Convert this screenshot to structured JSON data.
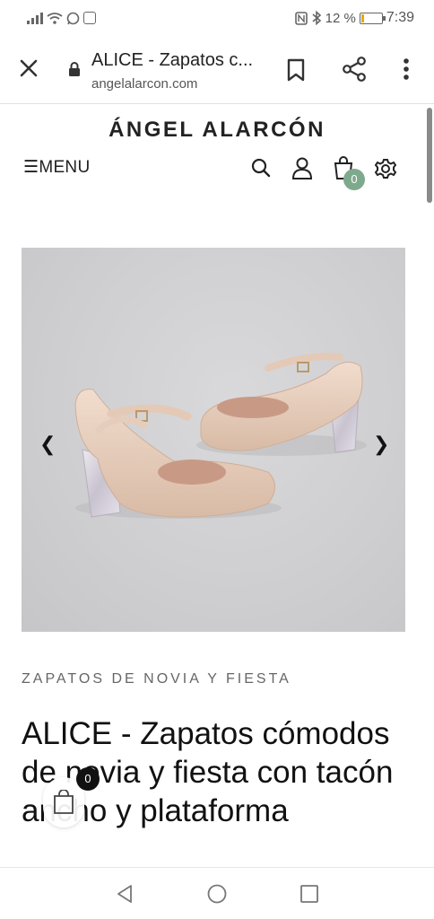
{
  "status_bar": {
    "battery_percent": "12 %",
    "battery_level": 0.12,
    "time": "7:39",
    "battery_color": "#f0a800"
  },
  "browser": {
    "title": "ALICE - Zapatos c...",
    "url": "angelalarcon.com",
    "icons": [
      "close-icon",
      "lock-icon",
      "bookmark-icon",
      "share-icon",
      "more-vert-icon"
    ]
  },
  "site": {
    "brand": "ÁNGEL ALARCÓN",
    "menu_label": "☰MENU",
    "cart_count": "0",
    "accent_color": "#7fa98c",
    "icons": [
      "search-icon",
      "user-icon",
      "shopping-bag-icon",
      "gear-icon"
    ]
  },
  "product": {
    "image": "pink-patent-mary-jane-heels-glitter-block-heel",
    "prev_arrow": "❮",
    "next_arrow": "❯",
    "category": "ZAPATOS DE NOVIA Y FIESTA",
    "title": "ALICE - Zapatos cómodos de novia y fiesta con tacón ancho y plataforma"
  },
  "floating_cart": {
    "count": "0"
  },
  "nav_bar": {
    "icons": [
      "back-triangle-icon",
      "home-circle-icon",
      "recents-square-icon"
    ]
  }
}
